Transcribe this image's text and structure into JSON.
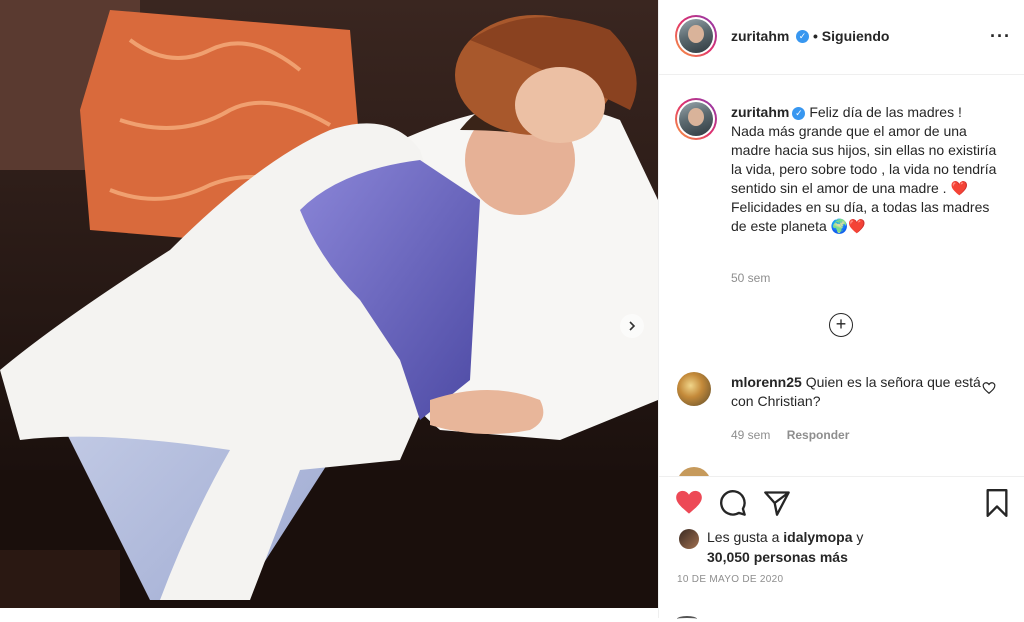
{
  "post": {
    "username": "zuritahm",
    "follow_status": "• Siguiendo",
    "more_icon": "···",
    "caption_username": "zuritahm",
    "caption_lines": [
      "Feliz día de las madres !",
      "Nada más grande que el amor de una madre hacia sus hijos, sin ellas no existiría la vida, pero sobre todo , la vida no tendría sentido sin el amor de una madre . ❤️",
      "Felicidades en su día, a todas las madres de este planeta 🌍❤️"
    ],
    "caption_time": "50 sem",
    "load_more_icon": "plus-circle-icon"
  },
  "comments": [
    {
      "username": "mlorenn25",
      "text": "Quien es la señora que está con Christian?",
      "time": "49 sem",
      "reply_label": "Responder"
    }
  ],
  "actions": {
    "like_icon": "heart-icon",
    "comment_icon": "comment-icon",
    "share_icon": "share-icon",
    "save_icon": "bookmark-icon",
    "liked": true,
    "like_color": "#ed4956"
  },
  "likes": {
    "prefix": "Les gusta a ",
    "user": "idalymopa",
    "suffix": " y",
    "count_text": "30,050 personas más"
  },
  "date": "10 DE MAYO DE 2020",
  "colors": {
    "verified": "#3897f0",
    "muted": "#8e8e8e",
    "text": "#262626"
  }
}
